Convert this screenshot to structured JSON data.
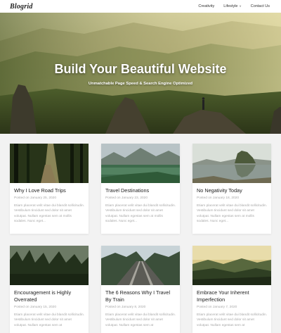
{
  "header": {
    "logo": "Blogrid",
    "nav": [
      {
        "label": "Creativity"
      },
      {
        "label": "Lifestyle"
      },
      {
        "label": "Contact Us"
      }
    ]
  },
  "hero": {
    "title": "Build Your Beautiful Website",
    "subtitle": "Unmatchable Page Speed & Search Engine Optimized"
  },
  "posts": [
    {
      "title": "Why I Love Road Trips",
      "date": "Posted on January 25, 2020",
      "excerpt": "Etiam placerat velit vitae dui blandit sollicitudin. Vestibulum tincidunt sed dolor sit amet volutpat. Nullam egestas sem at mollis sodales. Nunc eget..."
    },
    {
      "title": "Travel Destinations",
      "date": "Posted on January 23, 2020",
      "excerpt": "Etiam placerat velit vitae dui blandit sollicitudin. Vestibulum tincidunt sed dolor sit amet volutpat. Nullam egestas sem at mollis sodales. Nunc eget..."
    },
    {
      "title": "No Negativity Today",
      "date": "Posted on January 18, 2020",
      "excerpt": "Etiam placerat velit vitae dui blandit sollicitudin. Vestibulum tincidunt sed dolor sit amet volutpat. Nullam egestas sem at mollis sodales. Nunc eget..."
    },
    {
      "title": "Encouragement is Highly Overrated",
      "date": "Posted on January 15, 2020",
      "excerpt": "Etiam placerat velit vitae dui blandit sollicitudin. Vestibulum tincidunt sed dolor sit amet volutpat. Nullam egestas sem at"
    },
    {
      "title": "The 6 Reasons Why I Travel By Train",
      "date": "Posted on January 8, 2020",
      "excerpt": "Etiam placerat velit vitae dui blandit sollicitudin. Vestibulum tincidunt sed dolor sit amet volutpat. Nullam egestas sem at"
    },
    {
      "title": "Embrace Your Inherent Imperfection",
      "date": "Posted on January 7, 2020",
      "excerpt": "Etiam placerat velit vitae dui blandit sollicitudin. Vestibulum tincidunt sed dolor sit amet volutpat. Nullam egestas sem at"
    }
  ]
}
